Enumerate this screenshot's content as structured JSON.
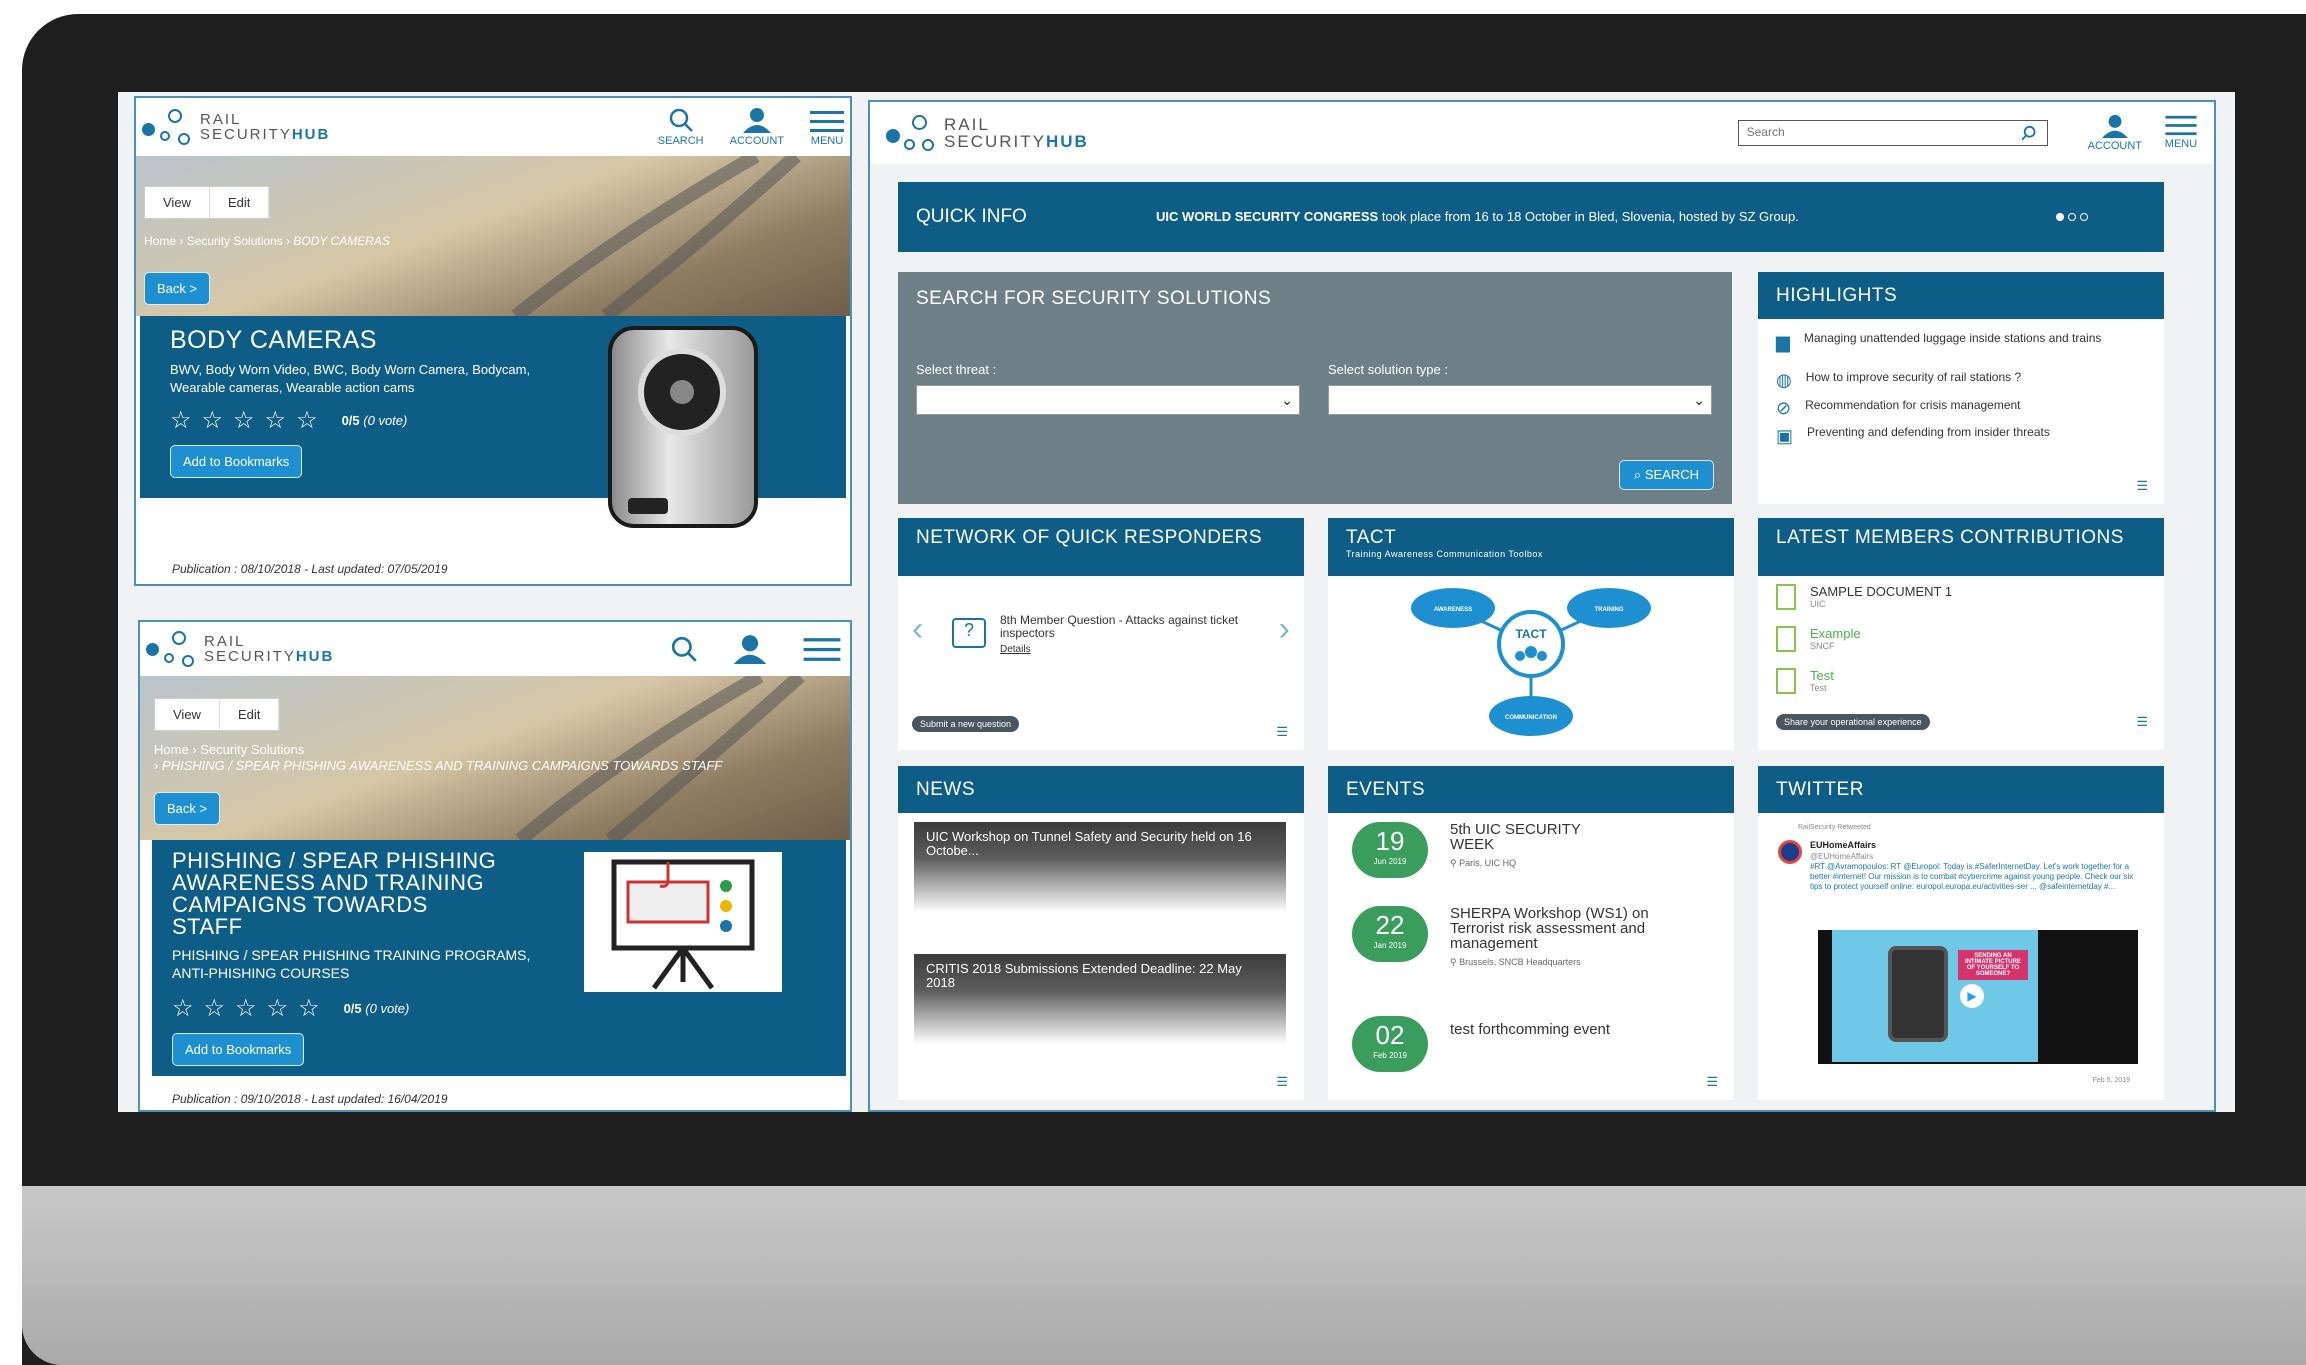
{
  "product": {
    "word1": "RAIL",
    "word2": "SECURITY",
    "word3": "HUB"
  },
  "mobile1": {
    "header": {
      "search": "SEARCH",
      "account": "ACCOUNT",
      "menu": "MENU"
    },
    "tabs": [
      "View",
      "Edit"
    ],
    "breadcrumb": {
      "home": "Home",
      "section": "Security Solutions",
      "current": "BODY CAMERAS"
    },
    "back": "Back >",
    "title": "BODY CAMERAS",
    "keywords": "BWV, Body Worn Video, BWC, Body Worn Camera, Bodycam, Wearable cameras, Wearable action cams",
    "rating": "0/5",
    "votes": "(0 vote)",
    "bookmark": "Add to Bookmarks",
    "publication": "Publication : 08/10/2018  -  Last updated: 07/05/2019"
  },
  "mobile2": {
    "tabs": [
      "View",
      "Edit"
    ],
    "breadcrumb": {
      "home": "Home",
      "section": "Security Solutions",
      "current": "PHISHING / SPEAR PHISHING AWARENESS AND TRAINING CAMPAIGNS TOWARDS STAFF"
    },
    "back": "Back >",
    "title": "PHISHING / SPEAR PHISHING AWARENESS AND TRAINING CAMPAIGNS TOWARDS STAFF",
    "keywords": "PHISHING / SPEAR PHISHING TRAINING PROGRAMS, ANTI-PHISHING COURSES",
    "rating": "0/5",
    "votes": "(0 vote)",
    "bookmark": "Add to Bookmarks",
    "publication": "Publication : 09/10/2018  -  Last updated: 16/04/2019"
  },
  "desktop": {
    "search_placeholder": "Search",
    "account": "ACCOUNT",
    "menu": "MENU",
    "quick_info": {
      "label": "QUICK INFO",
      "bold": "UIC WORLD SECURITY CONGRESS",
      "text": " took place from 16 to 18 October in Bled, Slovenia, hosted by SZ Group."
    },
    "search_solutions": {
      "title": "SEARCH FOR SECURITY SOLUTIONS",
      "threat_label": "Select threat :",
      "type_label": "Select solution type :",
      "button": "SEARCH"
    },
    "highlights": {
      "title": "HIGHLIGHTS",
      "items": [
        "Managing unattended luggage inside stations and trains",
        "How to improve security of rail stations ?",
        "Recommendation for crisis management",
        "Preventing and defending from insider threats"
      ]
    },
    "network": {
      "title": "NETWORK OF QUICK RESPONDERS",
      "question": "8th Member Question - Attacks against ticket inspectors",
      "details": "Details",
      "submit": "Submit a new question"
    },
    "tact": {
      "title": "TACT",
      "subtitle": "Training Awareness Communication Toolbox",
      "center": "TACT",
      "nodes": [
        "AWARENESS",
        "TRAINING",
        "COMMUNICATION"
      ]
    },
    "latest": {
      "title": "LATEST MEMBERS CONTRIBUTIONS",
      "items": [
        {
          "name": "SAMPLE DOCUMENT 1",
          "org": "UIC"
        },
        {
          "name": "Example",
          "org": "SNCF"
        },
        {
          "name": "Test",
          "org": "Test"
        }
      ],
      "share": "Share your operational experience"
    },
    "news": {
      "title": "NEWS",
      "items": [
        "UIC Workshop on Tunnel Safety and Security held on 16 Octobe...",
        "CRITIS 2018 Submissions Extended Deadline: 22 May 2018"
      ]
    },
    "events": {
      "title": "EVENTS",
      "items": [
        {
          "day": "19",
          "month": "Jun 2019",
          "title": "5th UIC SECURITY WEEK",
          "place": "Paris, UIC HQ"
        },
        {
          "day": "22",
          "month": "Jan 2019",
          "title": "SHERPA Workshop (WS1) on Terrorist risk assessment and management",
          "place": "Brussels, SNCB Headquarters"
        },
        {
          "day": "02",
          "month": "Feb 2019",
          "title": "test forthcomming event",
          "place": ""
        }
      ]
    },
    "twitter": {
      "title": "TWITTER",
      "retweet": "RailSecurity Retweeted",
      "user": "EUHomeAffairs",
      "handle": "@EUHomeAffairs",
      "text": "#RT @Avramopoulos: RT @Europol: Today is #SaferInternetDay. Let's work together for a better #internet! Our mission is to combat #cybercrime against young people. Check our six tips to protect yourself online: europol.europa.eu/activities-ser ... @safeinternetday #...",
      "media_caption": "SENDING AN INTIMATE PICTURE OF YOURSELF TO SOMEONE?",
      "date": "Feb 5, 2019"
    }
  },
  "colors": {
    "brand": "#0e5d86",
    "accent": "#1e8fd0",
    "event_green": "#3a9d5d"
  }
}
